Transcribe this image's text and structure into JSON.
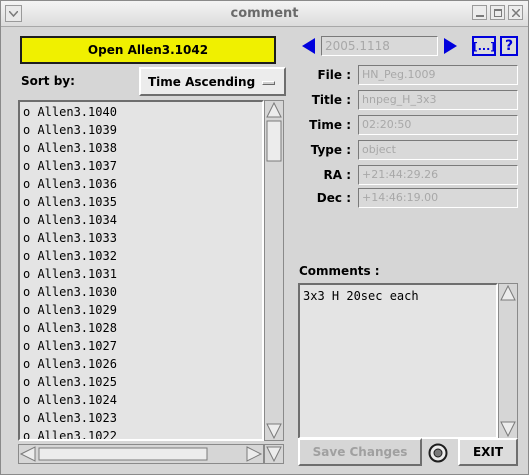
{
  "window": {
    "title": "comment",
    "menu_icon": "chevron-down-icon",
    "minimize_icon": "minimize-icon",
    "maximize_icon": "maximize-icon",
    "close_icon": "close-icon"
  },
  "left": {
    "open_button": "Open Allen3.1042",
    "open_button_color": "#f0f000",
    "sort_label": "Sort by:",
    "sort_value": "Time Ascending",
    "items": [
      "o Allen3.1040",
      "o Allen3.1039",
      "o Allen3.1038",
      "o Allen3.1037",
      "o Allen3.1036",
      "o Allen3.1035",
      "o Allen3.1034",
      "o Allen3.1033",
      "o Allen3.1032",
      "o Allen3.1031",
      "o Allen3.1030",
      "o Allen3.1029",
      "o Allen3.1028",
      "o Allen3.1027",
      "o Allen3.1026",
      "o Allen3.1025",
      "o Allen3.1024",
      "o Allen3.1023",
      "o Allen3.1022"
    ]
  },
  "right": {
    "date": "2005.1118",
    "nav_prev_icon": "arrow-left-icon",
    "nav_next_icon": "arrow-right-icon",
    "ellipsis_label": "[...]",
    "help_label": "?",
    "accent_color": "#0000dd",
    "fields": [
      {
        "label": "File :",
        "value": "HN_Peg.1009"
      },
      {
        "label": "Title :",
        "value": "hnpeg_H_3x3"
      },
      {
        "label": "Time :",
        "value": "02:20:50"
      },
      {
        "label": "Type :",
        "value": "object"
      },
      {
        "label": "RA :",
        "value": "+21:44:29.26"
      },
      {
        "label": "Dec :",
        "value": "+14:46:19.00"
      }
    ],
    "comments_label": "Comments :",
    "comments_text": "3x3 H 20sec each",
    "save_button": "Save Changes",
    "busy_icon": "busy-indicator-icon",
    "exit_button": "EXIT"
  }
}
